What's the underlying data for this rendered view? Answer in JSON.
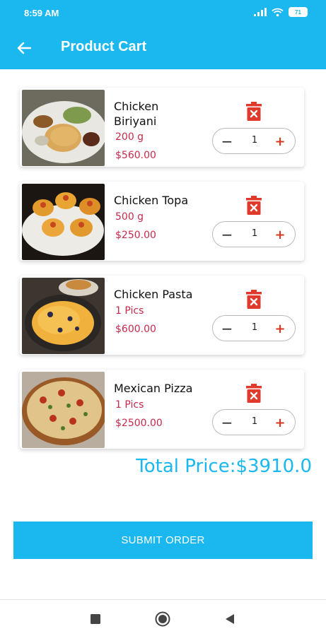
{
  "status_bar": {
    "time": "8:59 AM",
    "battery": "71"
  },
  "app_bar": {
    "title": "Product Cart"
  },
  "cart": {
    "items": [
      {
        "name": "Chicken Biriyani",
        "quantity_text": "200 g",
        "price": "$560.00",
        "count": "1",
        "photo": "biriyani-plate"
      },
      {
        "name": "Chicken Topa",
        "quantity_text": "500 g",
        "price": "$250.00",
        "count": "1",
        "photo": "chicken-topa"
      },
      {
        "name": "Chicken Pasta",
        "quantity_text": "1 Pics",
        "price": "$600.00",
        "count": "1",
        "photo": "chicken-pasta"
      },
      {
        "name": "Mexican Pizza",
        "quantity_text": "1 Pics",
        "price": "$2500.00",
        "count": "1",
        "photo": "mexican-pizza"
      }
    ],
    "minus_symbol": "−",
    "plus_symbol": "+"
  },
  "total": {
    "label": "Total Price:$3910.0"
  },
  "submit": {
    "label": "SUBMIT ORDER"
  },
  "colors": {
    "accent": "#1ab8ee",
    "price": "#c62a4a",
    "delete": "#e03a2d",
    "plus": "#d9361e"
  },
  "icons": {
    "back": "arrow-left-icon",
    "delete": "trash-x-icon",
    "nav": [
      "square-icon",
      "circle-icon",
      "triangle-left-icon"
    ]
  }
}
